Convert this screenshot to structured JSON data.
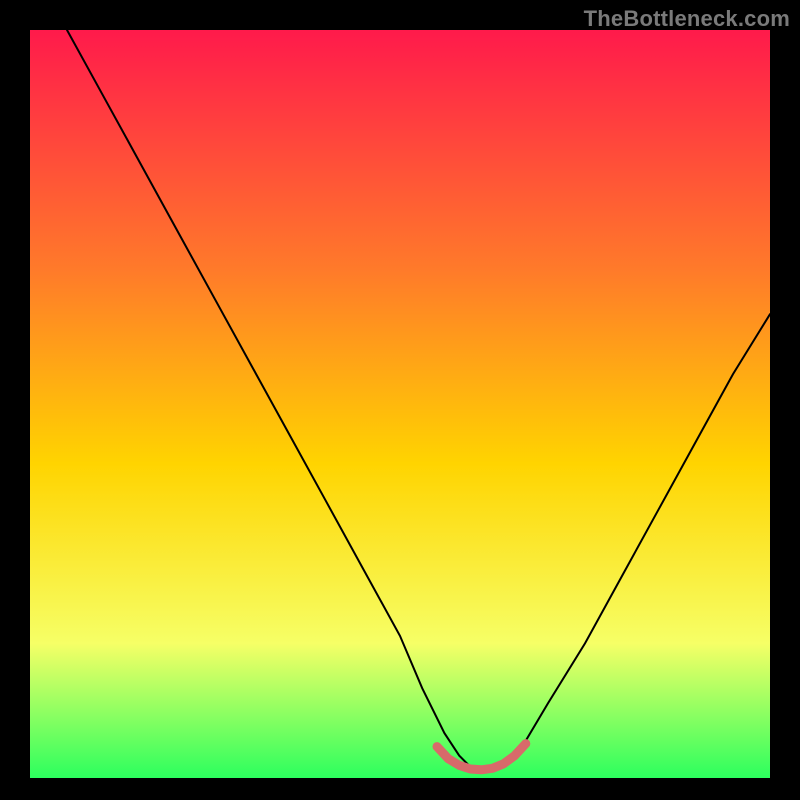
{
  "watermark": "TheBottleneck.com",
  "colors": {
    "bg": "#000000",
    "grad_top": "#ff1a4b",
    "grad_upper_mid": "#ff7a2a",
    "grad_mid": "#ffd400",
    "grad_lower_mid": "#f6ff66",
    "grad_bottom": "#2cff5e",
    "curve": "#000000",
    "marker": "#d86a6a"
  },
  "chart_data": {
    "type": "line",
    "title": "",
    "xlabel": "",
    "ylabel": "",
    "xlim": [
      0,
      100
    ],
    "ylim": [
      0,
      100
    ],
    "series": [
      {
        "name": "bottleneck-curve",
        "x": [
          5,
          10,
          15,
          20,
          25,
          30,
          35,
          40,
          45,
          50,
          53,
          56,
          58,
          60,
          62,
          64,
          67,
          70,
          75,
          80,
          85,
          90,
          95,
          100
        ],
        "y": [
          100,
          91,
          82,
          73,
          64,
          55,
          46,
          37,
          28,
          19,
          12,
          6,
          3,
          1,
          1,
          2,
          5,
          10,
          18,
          27,
          36,
          45,
          54,
          62
        ]
      }
    ],
    "trough_marker": {
      "name": "optimal-region",
      "x": [
        55,
        56.5,
        58,
        59.5,
        61,
        62.5,
        64,
        65.5,
        67
      ],
      "y": [
        4.2,
        2.6,
        1.7,
        1.2,
        1.1,
        1.3,
        1.9,
        3.0,
        4.6
      ]
    }
  }
}
